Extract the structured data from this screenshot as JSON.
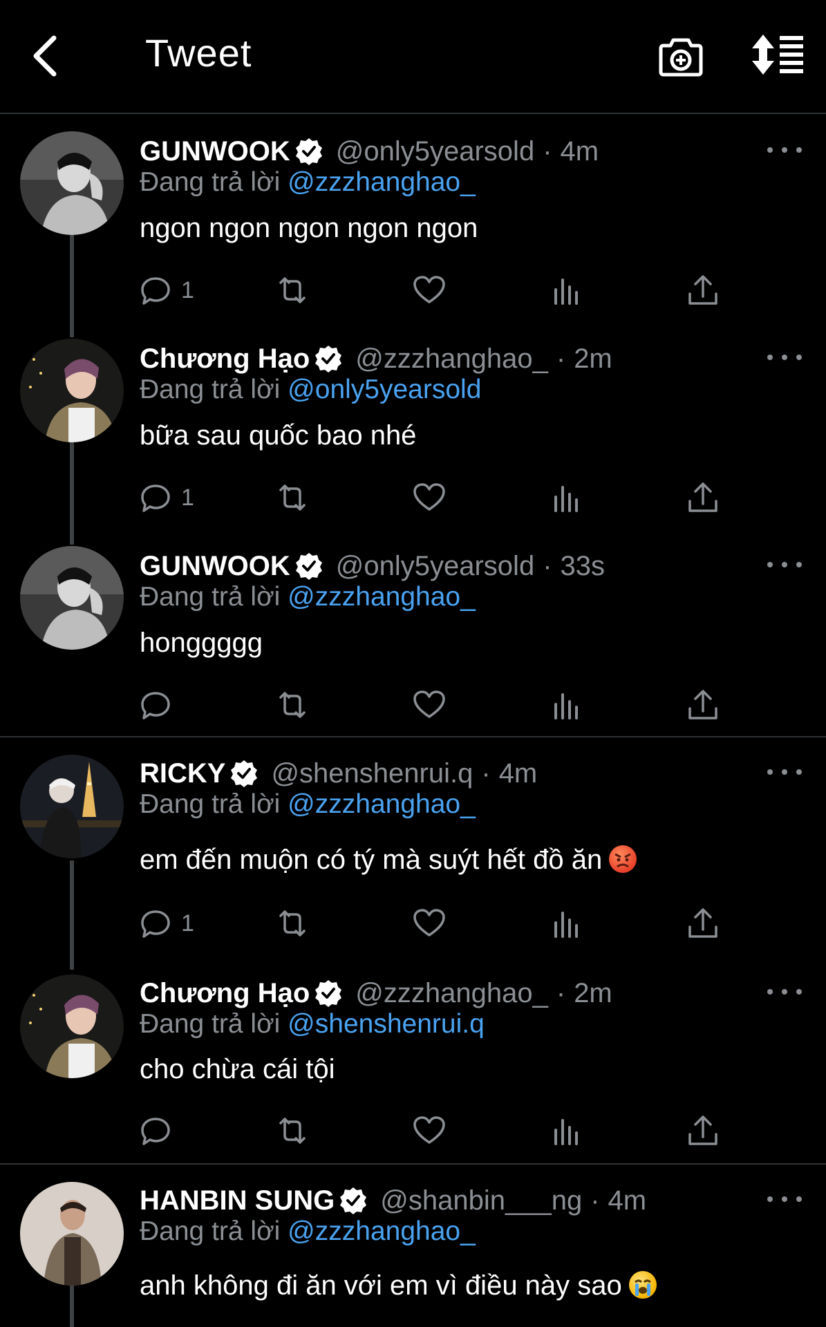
{
  "header": {
    "title": "Tweet",
    "back_icon": "chevron-left-icon",
    "camera_icon": "camera-plus-icon",
    "sort_icon": "sort-lines-icon"
  },
  "colors": {
    "background": "#000000",
    "link": "#4aa3f0",
    "muted": "#8b8f94",
    "divider": "#2f3336"
  },
  "reply_prefix": "Đang trả lời",
  "tweets": [
    {
      "name": "GUNWOOK",
      "handle": "@only5yearsold",
      "time": "4m",
      "reply_to": "@zzzhanghao_",
      "text": "ngon ngon ngon ngon ngon",
      "reply_count": "1",
      "avatar": "bw-portrait"
    },
    {
      "name": "Chương Hạo",
      "handle": "@zzzhanghao_",
      "time": "2m",
      "reply_to": "@only5yearsold",
      "text": "bữa sau quốc bao nhé",
      "reply_count": "1",
      "avatar": "night-portrait"
    },
    {
      "name": "GUNWOOK",
      "handle": "@only5yearsold",
      "time": "33s",
      "reply_to": "@zzzhanghao_",
      "text": "honggggg",
      "reply_count": "",
      "avatar": "bw-portrait"
    },
    {
      "name": "RICKY",
      "handle": "@shenshenrui.q",
      "time": "4m",
      "reply_to": "@zzzhanghao_",
      "text": "em đến muộn có tý mà suýt hết đồ ăn",
      "emoji": "angry-face-emoji",
      "reply_count": "1",
      "avatar": "eiffel-portrait"
    },
    {
      "name": "Chương Hạo",
      "handle": "@zzzhanghao_",
      "time": "2m",
      "reply_to": "@shenshenrui.q",
      "text": "cho chừa cái tội",
      "reply_count": "",
      "avatar": "night-portrait"
    },
    {
      "name": "HANBIN SUNG",
      "handle": "@shanbin___ng",
      "time": "4m",
      "reply_to": "@zzzhanghao_",
      "text": "anh không đi ăn với em vì điều này sao",
      "emoji": "crying-face-emoji",
      "reply_count": "",
      "avatar": "studio-portrait"
    }
  ]
}
